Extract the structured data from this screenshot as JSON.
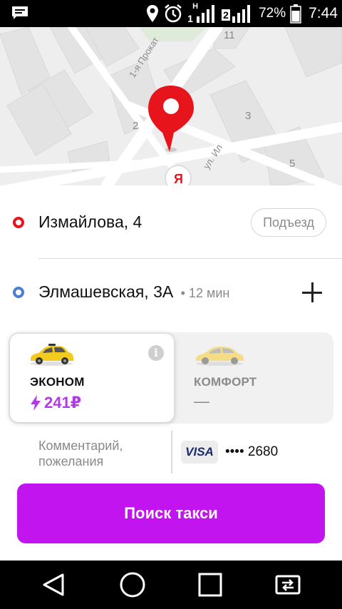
{
  "status_bar": {
    "battery_percent": "72%",
    "time": "7:44",
    "network_1": "H",
    "sim_1": "1",
    "sim_2": "2"
  },
  "map": {
    "street_label_1": "1-я Прокат",
    "street_label_2": "ул. Ил",
    "house_numbers": [
      "11",
      "3",
      "2",
      "5"
    ],
    "logo_letter": "Я"
  },
  "route": {
    "from_address": "Измайлова, 4",
    "entrance_label": "Подъезд",
    "to_address": "Элмашевская, 3А",
    "to_eta": "• 12 мин"
  },
  "tariffs": [
    {
      "name": "ЭКОНОМ",
      "price": "241₽",
      "selected": true
    },
    {
      "name": "КОМФОРТ",
      "price": "—",
      "selected": false
    }
  ],
  "comment_placeholder": "Комментарий, пожелания",
  "payment": {
    "card_brand": "VISA",
    "card_masked": "•••• 2680"
  },
  "search_button": "Поиск такси",
  "colors": {
    "accent": "#c114ee",
    "price": "#b23be8",
    "pin": "#e8141c",
    "from_dot": "#e8141c",
    "to_dot": "#4a7fd4"
  }
}
